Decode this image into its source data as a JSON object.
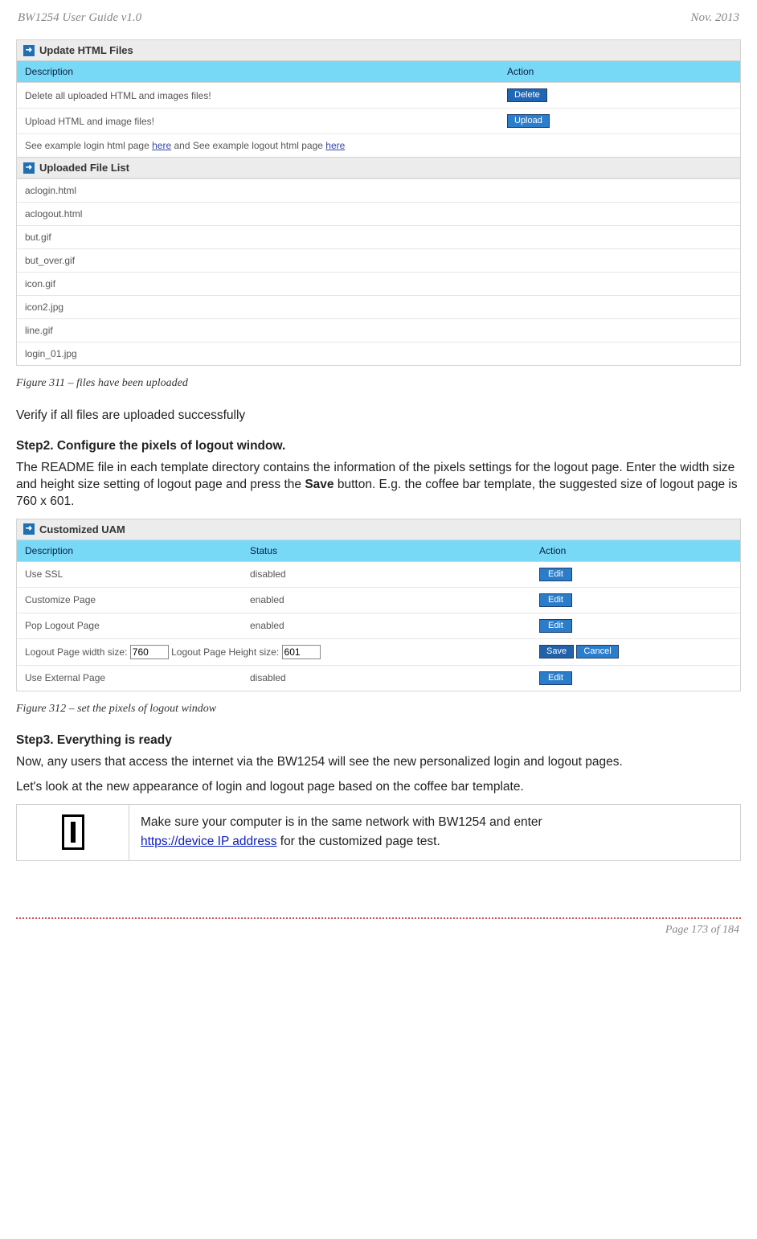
{
  "header": {
    "left": "BW1254 User Guide v1.0",
    "right": "Nov.  2013"
  },
  "fig1": {
    "panel_title": "Update HTML Files",
    "columns": [
      "Description",
      "Action"
    ],
    "row1_desc": "Delete all uploaded HTML and images files!",
    "row1_btn": "Delete",
    "row2_desc": "Upload HTML and image files!",
    "row2_btn": "Upload",
    "row3_pre": "See example login html page ",
    "row3_link1": "here",
    "row3_mid": " and See example logout html page ",
    "row3_link2": "here",
    "list_title": "Uploaded File List",
    "files": [
      "aclogin.html",
      "aclogout.html",
      "but.gif",
      "but_over.gif",
      "icon.gif",
      "icon2.jpg",
      "line.gif",
      "login_01.jpg"
    ],
    "caption": "Figure 311  – files have been uploaded"
  },
  "para_verify": "Verify if all files are uploaded successfully",
  "step2": {
    "heading": "Step2. Configure the pixels of logout window.",
    "p1a": "The README file in each template directory contains the information of the pixels settings for the logout page. Enter the width size and height size setting of logout page and press the ",
    "save_word": "Save",
    "p1b": " button. E.g. the coffee bar template, the suggested size of logout page is 760 x 601."
  },
  "fig2": {
    "panel_title": "Customized UAM",
    "columns": [
      "Description",
      "Status",
      "Action"
    ],
    "rows": [
      {
        "desc": "Use SSL",
        "status": "disabled",
        "btn": "Edit"
      },
      {
        "desc": "Customize Page",
        "status": "enabled",
        "btn": "Edit"
      },
      {
        "desc": "Pop Logout Page",
        "status": "enabled",
        "btn": "Edit"
      }
    ],
    "size_row": {
      "w_label": "Logout Page width size: ",
      "w_value": "760",
      "h_label": "   Logout Page Height size: ",
      "h_value": "601",
      "save": "Save",
      "cancel": "Cancel"
    },
    "last_row": {
      "desc": "Use External Page",
      "status": "disabled",
      "btn": "Edit"
    },
    "caption": "Figure 312  – set the pixels of logout window"
  },
  "step3": {
    "heading": "Step3. Everything is ready",
    "p1": "Now, any users that access the internet via the BW1254 will see the new personalized login and logout pages.",
    "p2": "Let's look at the new appearance of login and logout page based on the coffee bar template."
  },
  "info": {
    "line1": "Make sure your computer is in the same network with BW1254 and enter",
    "link": " https://device IP address",
    "line2_tail": " for the customized page test."
  },
  "footer": "Page 173 of 184"
}
